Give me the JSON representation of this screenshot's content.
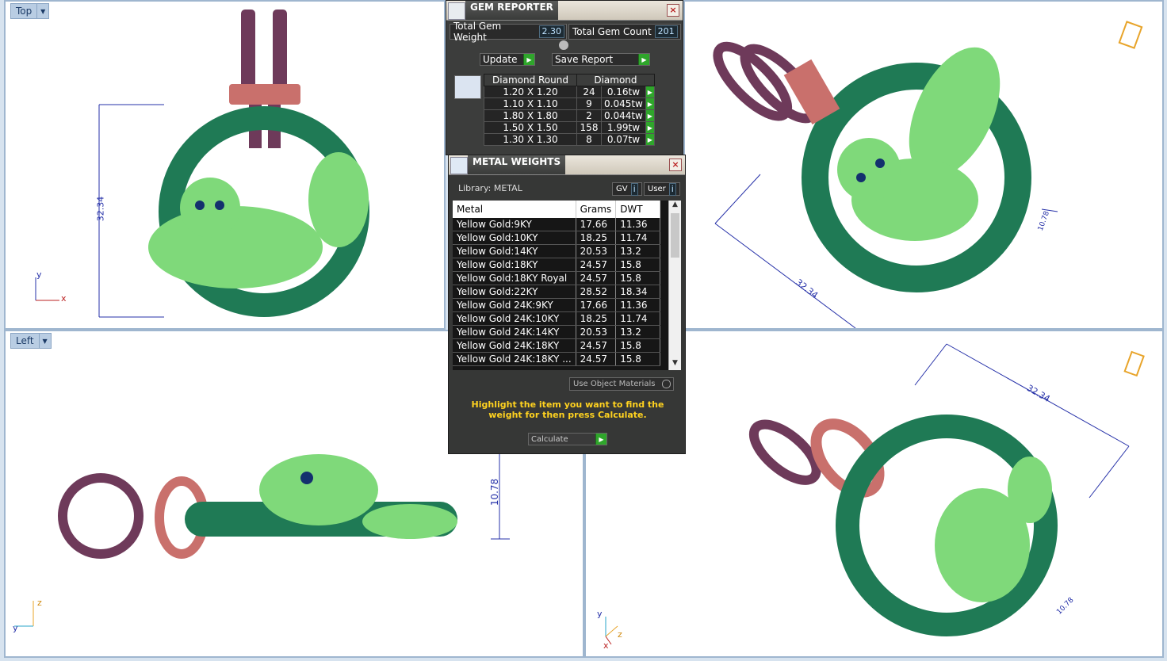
{
  "viewports": {
    "top": {
      "label": "Top",
      "dim": "32.34",
      "axis_x": "x",
      "axis_y": "y"
    },
    "perspective_top": {
      "dim_long": "32.34",
      "dim_short": "10.78"
    },
    "left": {
      "label": "Left",
      "dim": "10.78",
      "axis_z": "z",
      "axis_y": "y"
    },
    "perspective_bottom": {
      "dim_long": "32.34",
      "dim_short": "10.78",
      "axis_y": "y",
      "axis_z": "z",
      "axis_x": "x"
    }
  },
  "gem_reporter": {
    "title": "GEM REPORTER",
    "total_weight_label": "Total Gem Weight",
    "total_weight_value": "2.30",
    "total_count_label": "Total Gem Count",
    "total_count_value": "201",
    "update_label": "Update",
    "save_report_label": "Save Report",
    "columns": [
      "Diamond Round",
      "Diamond"
    ],
    "rows": [
      {
        "size": "1.20 X 1.20",
        "count": "24",
        "weight": "0.16tw"
      },
      {
        "size": "1.10 X 1.10",
        "count": "9",
        "weight": "0.045tw"
      },
      {
        "size": "1.80 X 1.80",
        "count": "2",
        "weight": "0.044tw"
      },
      {
        "size": "1.50 X 1.50",
        "count": "158",
        "weight": "1.99tw"
      },
      {
        "size": "1.30 X 1.30",
        "count": "8",
        "weight": "0.07tw"
      }
    ]
  },
  "metal_weights": {
    "title": "METAL WEIGHTS",
    "library_label": "Library: METAL",
    "gv_label": "GV",
    "user_label": "User",
    "columns": [
      "Metal",
      "Grams",
      "DWT"
    ],
    "rows": [
      {
        "metal": "Yellow Gold:9KY",
        "grams": "17.66",
        "dwt": "11.36"
      },
      {
        "metal": "Yellow Gold:10KY",
        "grams": "18.25",
        "dwt": "11.74"
      },
      {
        "metal": "Yellow Gold:14KY",
        "grams": "20.53",
        "dwt": "13.2"
      },
      {
        "metal": "Yellow Gold:18KY",
        "grams": "24.57",
        "dwt": "15.8"
      },
      {
        "metal": "Yellow Gold:18KY Royal",
        "grams": "24.57",
        "dwt": "15.8"
      },
      {
        "metal": "Yellow Gold:22KY",
        "grams": "28.52",
        "dwt": "18.34"
      },
      {
        "metal": "Yellow Gold 24K:9KY",
        "grams": "17.66",
        "dwt": "11.36"
      },
      {
        "metal": "Yellow Gold 24K:10KY",
        "grams": "18.25",
        "dwt": "11.74"
      },
      {
        "metal": "Yellow Gold 24K:14KY",
        "grams": "20.53",
        "dwt": "13.2"
      },
      {
        "metal": "Yellow Gold 24K:18KY",
        "grams": "24.57",
        "dwt": "15.8"
      },
      {
        "metal": "Yellow Gold 24K:18KY ...",
        "grams": "24.57",
        "dwt": "15.8"
      }
    ],
    "use_object_materials_label": "Use Object Materials",
    "hint": "Highlight the item you want to find the weight for then press Calculate.",
    "calculate_label": "Calculate"
  },
  "colors": {
    "ring_green": "#1f7a55",
    "body_green": "#7fd97a",
    "band_pink": "#c9706c",
    "band_purple": "#6e3a5a",
    "gem_blue": "#8fb3e3",
    "hint_yellow": "#ffd21f",
    "dim_blue": "#2530a8"
  }
}
